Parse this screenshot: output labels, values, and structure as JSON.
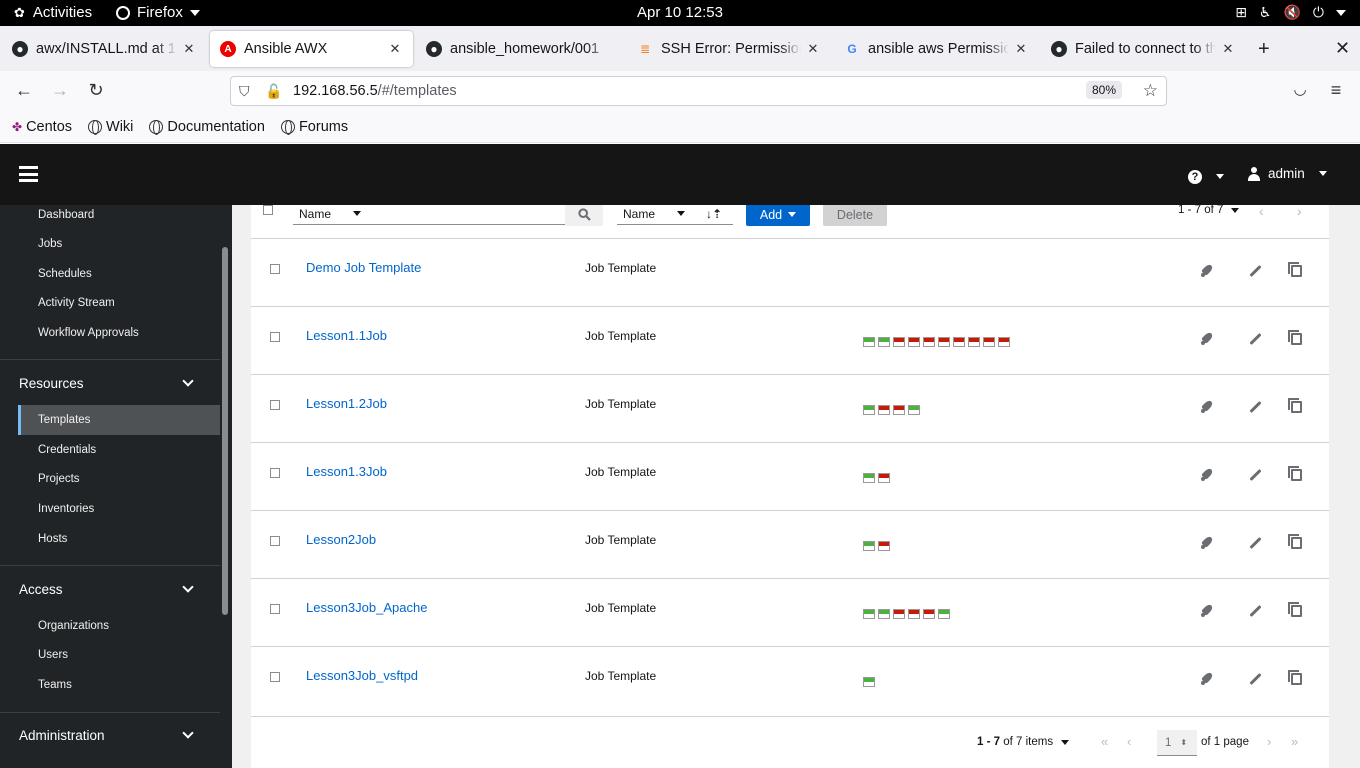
{
  "system": {
    "activities": "Activities",
    "app": "Firefox",
    "clock": "Apr 10  12:53"
  },
  "browser": {
    "tabs": [
      {
        "title": "awx/INSTALL.md at 17.",
        "favicon": "github-icon"
      },
      {
        "title": "Ansible AWX",
        "favicon": "ansible-icon"
      },
      {
        "title": "ansible_homework/001",
        "favicon": "github-icon"
      },
      {
        "title": "SSH Error: Permission d",
        "favicon": "stackoverflow-icon"
      },
      {
        "title": "ansible aws Permission",
        "favicon": "google-icon"
      },
      {
        "title": "Failed to connect to the",
        "favicon": "github-icon"
      }
    ],
    "url_host": "192.168.56.5",
    "url_path": "/#/templates",
    "zoom": "80%",
    "bookmarks": [
      "Centos",
      "Wiki",
      "Documentation",
      "Forums"
    ]
  },
  "header": {
    "user": "admin"
  },
  "sidebar": {
    "top_items": [
      "Dashboard",
      "Jobs",
      "Schedules",
      "Activity Stream",
      "Workflow Approvals"
    ],
    "resources": {
      "label": "Resources",
      "items": [
        "Templates",
        "Credentials",
        "Projects",
        "Inventories",
        "Hosts"
      ]
    },
    "access": {
      "label": "Access",
      "items": [
        "Organizations",
        "Users",
        "Teams"
      ]
    },
    "administration": {
      "label": "Administration"
    }
  },
  "toolbar": {
    "search_key": "Name",
    "sort_key": "Name",
    "add_label": "Add",
    "delete_label": "Delete",
    "range_top": "1 - 7 of 7"
  },
  "templates": [
    {
      "name": "Demo Job Template",
      "type": "Job Template",
      "jobs": []
    },
    {
      "name": "Lesson1.1Job",
      "type": "Job Template",
      "jobs": [
        "ok",
        "ok",
        "fail",
        "fail",
        "fail",
        "fail",
        "fail",
        "fail",
        "fail",
        "fail"
      ]
    },
    {
      "name": "Lesson1.2Job",
      "type": "Job Template",
      "jobs": [
        "ok",
        "fail",
        "fail",
        "ok"
      ]
    },
    {
      "name": "Lesson1.3Job",
      "type": "Job Template",
      "jobs": [
        "ok",
        "fail"
      ]
    },
    {
      "name": "Lesson2Job",
      "type": "Job Template",
      "jobs": [
        "ok",
        "fail"
      ]
    },
    {
      "name": "Lesson3Job_Apache",
      "type": "Job Template",
      "jobs": [
        "ok",
        "ok",
        "fail",
        "fail",
        "fail",
        "ok"
      ]
    },
    {
      "name": "Lesson3Job_vsftpd",
      "type": "Job Template",
      "jobs": [
        "ok"
      ]
    }
  ],
  "pagination": {
    "range_prefix": "1 - 7",
    "range_suffix": "of 7 items",
    "page": "1",
    "of_pages": "of 1 page"
  },
  "colors": {
    "accent": "#0066cc",
    "success": "#4cb140",
    "failure": "#c9190b",
    "header_bg": "#151515",
    "sidebar_bg": "#212427"
  }
}
